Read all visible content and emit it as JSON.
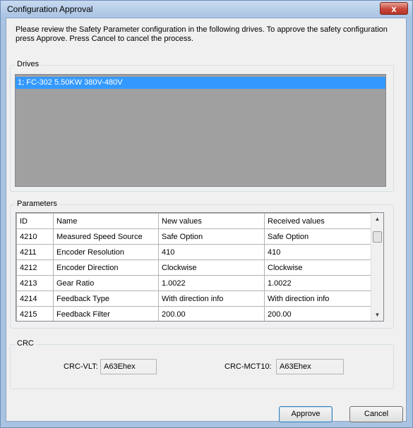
{
  "window": {
    "title": "Configuration Approval",
    "close_label": "x"
  },
  "instructions": "Please review the Safety Parameter configuration in the following drives. To approve the safety configuration press Approve. Press Cancel to cancel the process.",
  "drives": {
    "label": "Drives",
    "items": [
      "1; FC-302 5.50KW 380V-480V"
    ],
    "selected_index": 0
  },
  "parameters": {
    "label": "Parameters",
    "columns": [
      "ID",
      "Name",
      "New values",
      "Received values"
    ],
    "rows": [
      [
        "4210",
        "Measured Speed Source",
        "Safe Option",
        "Safe Option"
      ],
      [
        "4211",
        "Encoder Resolution",
        "410",
        "410"
      ],
      [
        "4212",
        "Encoder Direction",
        "Clockwise",
        "Clockwise"
      ],
      [
        "4213",
        "Gear Ratio",
        "1.0022",
        "1.0022"
      ],
      [
        "4214",
        "Feedback Type",
        "With direction info",
        "With direction info"
      ],
      [
        "4215",
        "Feedback Filter",
        "200.00",
        "200.00"
      ]
    ]
  },
  "crc": {
    "label": "CRC",
    "vlt_label": "CRC-VLT:",
    "vlt_value": "A63Ehex",
    "mct_label": "CRC-MCT10:",
    "mct_value": "A63Ehex"
  },
  "buttons": {
    "approve": "Approve",
    "cancel": "Cancel"
  },
  "colors": {
    "selection": "#3399ff",
    "list_background": "#a0a0a0",
    "close_button": "#c9463a"
  }
}
